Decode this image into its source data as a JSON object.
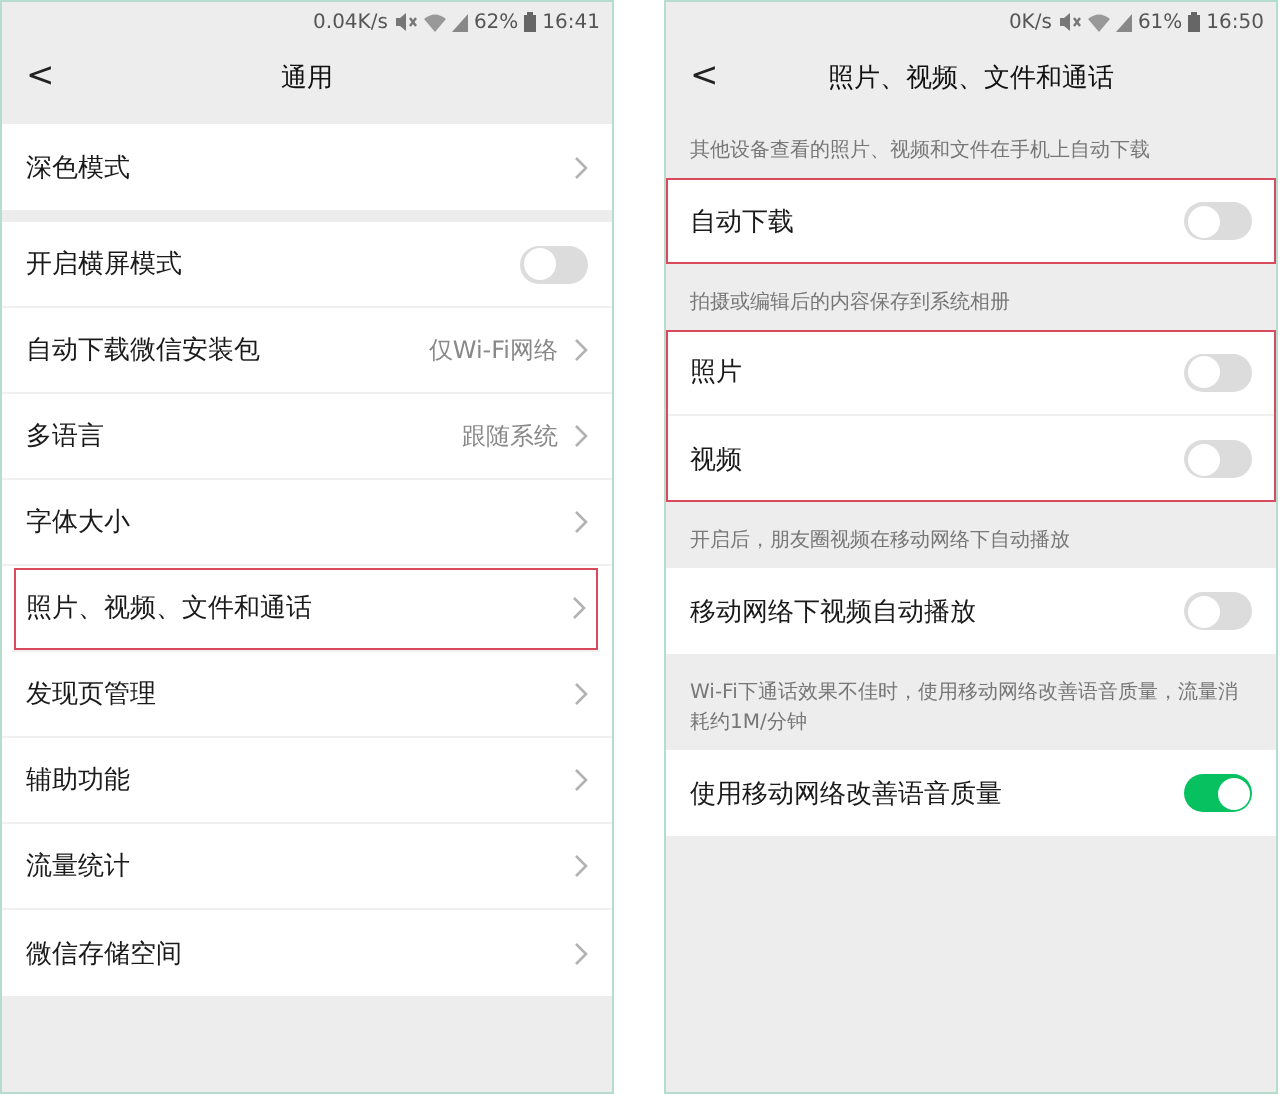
{
  "screens": [
    {
      "status_bar": {
        "speed": "0.04K/s",
        "battery": "62%",
        "time": "16:41"
      },
      "title": "通用",
      "back": "<",
      "groups": [
        {
          "rows": [
            {
              "kind": "link",
              "label": "深色模式",
              "highlighted": false
            }
          ]
        },
        {
          "rows": [
            {
              "kind": "toggle",
              "label": "开启横屏模式",
              "on": false,
              "highlighted": false
            },
            {
              "kind": "link",
              "label": "自动下载微信安装包",
              "value": "仅Wi-Fi网络",
              "highlighted": false
            },
            {
              "kind": "link",
              "label": "多语言",
              "value": "跟随系统",
              "highlighted": false
            },
            {
              "kind": "link",
              "label": "字体大小",
              "highlighted": false
            },
            {
              "kind": "link",
              "label": "照片、视频、文件和通话",
              "highlighted": true
            },
            {
              "kind": "link",
              "label": "发现页管理",
              "highlighted": false
            },
            {
              "kind": "link",
              "label": "辅助功能",
              "highlighted": false
            },
            {
              "kind": "link",
              "label": "流量统计",
              "highlighted": false
            },
            {
              "kind": "link",
              "label": "微信存储空间",
              "highlighted": false
            }
          ]
        }
      ]
    },
    {
      "status_bar": {
        "speed": "0K/s",
        "battery": "61%",
        "time": "16:50"
      },
      "title": "照片、视频、文件和通话",
      "back": "<",
      "groups": [
        {
          "note": "其他设备查看的照片、视频和文件在手机上自动下载",
          "highlighted": true,
          "rows": [
            {
              "kind": "toggle",
              "label": "自动下载",
              "on": false
            }
          ]
        },
        {
          "note": "拍摄或编辑后的内容保存到系统相册",
          "highlighted": true,
          "rows": [
            {
              "kind": "toggle",
              "label": "照片",
              "on": false
            },
            {
              "kind": "toggle",
              "label": "视频",
              "on": false
            }
          ]
        },
        {
          "note": "开启后，朋友圈视频在移动网络下自动播放",
          "highlighted": false,
          "rows": [
            {
              "kind": "toggle",
              "label": "移动网络下视频自动播放",
              "on": false
            }
          ]
        },
        {
          "note": "Wi-Fi下通话效果不佳时，使用移动网络改善语音质量，流量消耗约1M/分钟",
          "highlighted": false,
          "rows": [
            {
              "kind": "toggle",
              "label": "使用移动网络改善语音质量",
              "on": true
            }
          ]
        }
      ]
    }
  ]
}
